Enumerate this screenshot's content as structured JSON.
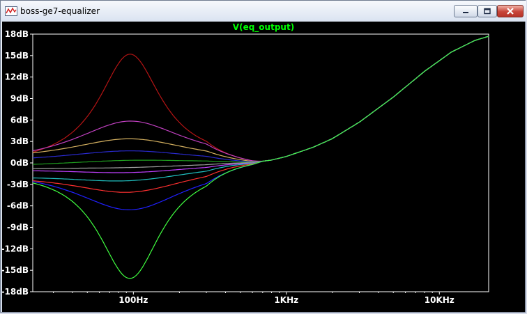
{
  "window": {
    "title": "boss-ge7-equalizer",
    "app_icon": "waveform-icon",
    "controls": {
      "minimize": "minimize-icon",
      "maximize": "maximize-icon",
      "close": "close-icon"
    }
  },
  "colors": {
    "plot_background": "#000000",
    "grid_and_text": "#ffffff",
    "trace_title": "#00ff00",
    "close_button": "#c7453a"
  },
  "chart_data": {
    "type": "line",
    "title": "V(eq_output)",
    "xlabel": "",
    "ylabel": "",
    "xscale": "log",
    "xlim": [
      22,
      21000
    ],
    "ylim": [
      -18,
      18
    ],
    "grid": false,
    "x_tick_labels": [
      {
        "label": "100Hz",
        "value": 100
      },
      {
        "label": "1KHz",
        "value": 1000
      },
      {
        "label": "10KHz",
        "value": 10000
      }
    ],
    "y_tick_labels": [
      {
        "label": "18dB",
        "value": 18
      },
      {
        "label": "15dB",
        "value": 15
      },
      {
        "label": "12dB",
        "value": 12
      },
      {
        "label": "9dB",
        "value": 9
      },
      {
        "label": "6dB",
        "value": 6
      },
      {
        "label": "3dB",
        "value": 3
      },
      {
        "label": "0dB",
        "value": 0
      },
      {
        "label": "-3dB",
        "value": -3
      },
      {
        "label": "-6dB",
        "value": -6
      },
      {
        "label": "-9dB",
        "value": -9
      },
      {
        "label": "-12dB",
        "value": -12
      },
      {
        "label": "-15dB",
        "value": -15
      },
      {
        "label": "-18dB",
        "value": -18
      }
    ],
    "x": [
      22,
      30,
      40,
      55,
      70,
      85,
      95,
      105,
      120,
      150,
      200,
      250,
      300,
      400,
      600,
      800,
      1000,
      1500,
      2000,
      3000,
      5000,
      8000,
      12000,
      17000,
      21000
    ],
    "common_tail": [
      0.05,
      0.4,
      0.9,
      2.2,
      3.4,
      5.7,
      9.2,
      12.8,
      15.5,
      17.1,
      17.7
    ],
    "series": [
      {
        "color": "#b41414",
        "peak": 15.5,
        "start": 1.5,
        "q": 0.25
      },
      {
        "color": "#c040c0",
        "peak": 6.0,
        "start": 1.7,
        "q": 0.45
      },
      {
        "color": "#d4b060",
        "peak": 3.3,
        "start": 1.4,
        "q": 0.5
      },
      {
        "color": "#2a2ad0",
        "peak": 1.7,
        "start": 0.7,
        "q": 0.55
      },
      {
        "color": "#20a020",
        "peak": 0.6,
        "start": -0.2,
        "q": 0.55
      },
      {
        "color": "#a0a0a0",
        "peak": -0.3,
        "start": -0.8,
        "q": 0.55
      },
      {
        "color": "#c040ff",
        "peak": -1.0,
        "start": -1.1,
        "q": 0.55
      },
      {
        "color": "#20c0c0",
        "peak": -1.8,
        "start": -2.1,
        "q": 0.55
      },
      {
        "color": "#ff3030",
        "peak": -3.5,
        "start": -2.5,
        "q": 0.5
      },
      {
        "color": "#2020ff",
        "peak": -6.3,
        "start": -2.6,
        "q": 0.45
      },
      {
        "color": "#40ff40",
        "peak": -15.8,
        "start": -2.8,
        "q": 0.25
      }
    ]
  }
}
